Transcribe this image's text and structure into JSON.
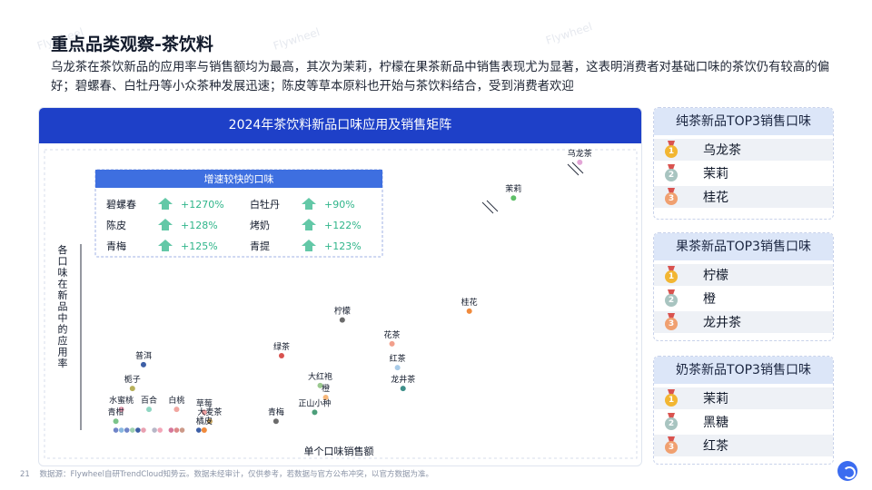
{
  "page": {
    "title": "重点品类观察-茶饮料",
    "description": "乌龙茶在茶饮新品的应用率与销售额均为最高，其次为茉莉，柠檬在果茶新品中销售表现尤为显著，这表明消费者对基础口味的茶饮仍有较高的偏好；碧螺春、白牡丹等小众茶种发展迅速；陈皮等草本原料也开始与茶饮料结合，受到消费者欢迎",
    "footer_page": "21",
    "footer_source": "数据源：Flywheel自研TrendCloud知势云。数据未经审计，仅供参考，若数据与官方公布冲突，以官方数据为准。",
    "watermark": "Flywheel"
  },
  "chart_data": {
    "type": "scatter",
    "title": "2024年茶饮料新品口味应用及销售矩阵",
    "xlabel": "单个口味销售额",
    "ylabel": "各口味在新品中的应用率",
    "points": [
      {
        "name": "乌龙茶",
        "x": 91,
        "y": 97,
        "color": "#e3a6d7"
      },
      {
        "name": "茉莉",
        "x": 79,
        "y": 85,
        "color": "#5fbf68"
      },
      {
        "name": "桂花",
        "x": 71,
        "y": 47,
        "color": "#f08a3c"
      },
      {
        "name": "柠檬",
        "x": 48,
        "y": 44,
        "color": "#6b6b6b"
      },
      {
        "name": "花茶",
        "x": 57,
        "y": 36,
        "color": "#f2a08c"
      },
      {
        "name": "红茶",
        "x": 58,
        "y": 28,
        "color": "#a8cbe8"
      },
      {
        "name": "龙井茶",
        "x": 59,
        "y": 21,
        "color": "#3e8f8a"
      },
      {
        "name": "绿茶",
        "x": 37,
        "y": 32,
        "color": "#d8524f"
      },
      {
        "name": "大红袍",
        "x": 44,
        "y": 22,
        "color": "#9bc98f"
      },
      {
        "name": "橙",
        "x": 45,
        "y": 18,
        "color": "#f7b77a"
      },
      {
        "name": "正山小种",
        "x": 43,
        "y": 13,
        "color": "#4c9e7a"
      },
      {
        "name": "青梅",
        "x": 36,
        "y": 10,
        "color": "#6b6b6b"
      },
      {
        "name": "普洱",
        "x": 12,
        "y": 29,
        "color": "#3d5fa6"
      },
      {
        "name": "栀子",
        "x": 10,
        "y": 21,
        "color": "#b7b05a"
      },
      {
        "name": "水蜜桃",
        "x": 8,
        "y": 14,
        "color": "#f3a6b8"
      },
      {
        "name": "百合",
        "x": 13,
        "y": 14,
        "color": "#8fd6c2"
      },
      {
        "name": "白桃",
        "x": 18,
        "y": 14,
        "color": "#f1a6a0"
      },
      {
        "name": "草莓",
        "x": 23,
        "y": 13,
        "color": "#f0a0a0"
      },
      {
        "name": "大麦茶",
        "x": 24,
        "y": 10,
        "color": "#c5a25b"
      },
      {
        "name": "青柑",
        "x": 7,
        "y": 10,
        "color": "#7cc48a"
      },
      {
        "name": "橘皮",
        "x": 23,
        "y": 7,
        "color": "#f08a3c"
      }
    ],
    "cluster_dots": [
      {
        "x": 7,
        "y": 7,
        "color": "#6f84c8"
      },
      {
        "x": 8,
        "y": 7,
        "color": "#88b7e0"
      },
      {
        "x": 9,
        "y": 7,
        "color": "#6f84c8"
      },
      {
        "x": 10,
        "y": 7,
        "color": "#9ed0b0"
      },
      {
        "x": 11,
        "y": 7,
        "color": "#3d5fa6"
      },
      {
        "x": 12,
        "y": 7,
        "color": "#e8a0b0"
      },
      {
        "x": 14,
        "y": 7,
        "color": "#b7b7c7"
      },
      {
        "x": 15,
        "y": 7,
        "color": "#f3a6b8"
      },
      {
        "x": 17,
        "y": 7,
        "color": "#d6779a"
      },
      {
        "x": 18,
        "y": 7,
        "color": "#d88"
      },
      {
        "x": 19,
        "y": 7,
        "color": "#c98"
      },
      {
        "x": 22,
        "y": 7,
        "color": "#3d5fa6"
      }
    ],
    "growth_box": {
      "title": "增速较快的口味",
      "items": [
        {
          "name": "碧螺春",
          "value": "+1270%"
        },
        {
          "name": "白牡丹",
          "value": "+90%"
        },
        {
          "name": "陈皮",
          "value": "+128%"
        },
        {
          "name": "烤奶",
          "value": "+122%"
        },
        {
          "name": "青梅",
          "value": "+125%"
        },
        {
          "name": "青提",
          "value": "+123%"
        }
      ],
      "up_color": "#2fb58a"
    }
  },
  "rankings": [
    {
      "title": "纯茶新品TOP3销售口味",
      "items": [
        "乌龙茶",
        "茉莉",
        "桂花"
      ]
    },
    {
      "title": "果茶新品TOP3销售口味",
      "items": [
        "柠檬",
        "橙",
        "龙井茶"
      ]
    },
    {
      "title": "奶茶新品TOP3销售口味",
      "items": [
        "茉莉",
        "黑糖",
        "红茶"
      ]
    }
  ],
  "colors": {
    "header_blue": "#1e40c8",
    "gold": "#f2b632",
    "silver": "#a8c4c0",
    "bronze": "#f0a070"
  }
}
